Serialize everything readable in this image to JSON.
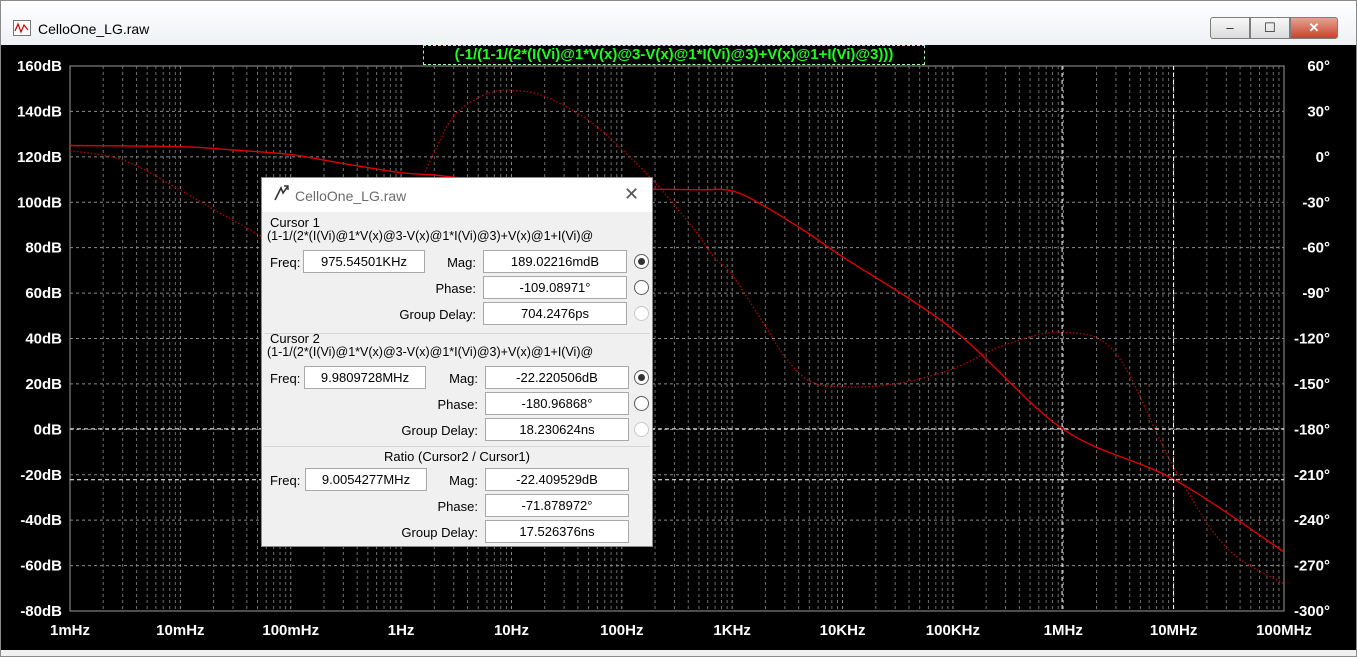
{
  "window": {
    "title": "CelloOne_LG.raw",
    "min_label": "‒",
    "max_label": "☐",
    "close_label": "✕"
  },
  "trace": {
    "expression": "(-1/(1-1/(2*(I(Vi)@1*V(x)@3-V(x)@1*I(Vi)@3)+V(x)@1+I(Vi)@3)))",
    "color": "#1cff1c"
  },
  "plot": {
    "x_ticks": [
      "1mHz",
      "10mHz",
      "100mHz",
      "1Hz",
      "10Hz",
      "100Hz",
      "1KHz",
      "10KHz",
      "100KHz",
      "1MHz",
      "10MHz",
      "100MHz"
    ],
    "y_left_ticks": [
      "160dB",
      "140dB",
      "120dB",
      "100dB",
      "80dB",
      "60dB",
      "40dB",
      "20dB",
      "0dB",
      "-20dB",
      "-40dB",
      "-60dB",
      "-80dB"
    ],
    "y_right_ticks": [
      "60°",
      "30°",
      "0°",
      "-30°",
      "-60°",
      "-90°",
      "-120°",
      "-150°",
      "-180°",
      "-210°",
      "-240°",
      "-270°",
      "-300°"
    ],
    "magnitude_color": "#e00000",
    "phase_color": "#b80000"
  },
  "chart_data": {
    "type": "line",
    "x_scale": "log",
    "x_unit": "Hz",
    "xlim": [
      0.001,
      100000000
    ],
    "ylim": [
      -80,
      160
    ],
    "y2lim": [
      -300,
      60
    ],
    "grid": true,
    "series": [
      {
        "axis": "left",
        "x": [
          0.001,
          0.01,
          0.03,
          0.1,
          0.3,
          1,
          2,
          3,
          5,
          10,
          20,
          50,
          100,
          200,
          500,
          1000,
          2000,
          5000,
          10000,
          100000,
          1000000,
          10000000,
          100000000
        ],
        "y": [
          125,
          124.5,
          123,
          121,
          117,
          113,
          112,
          111,
          110,
          108.5,
          107.5,
          106.5,
          106,
          105.7,
          105.5,
          105,
          98,
          86,
          76,
          44,
          0,
          -22,
          -54
        ]
      },
      {
        "axis": "right",
        "x": [
          0.001,
          0.003,
          0.01,
          0.03,
          0.1,
          0.3,
          0.5,
          1,
          2,
          3,
          5,
          7,
          10,
          20,
          50,
          100,
          200,
          300,
          500,
          700,
          1000,
          2000,
          3000,
          5000,
          10000,
          30000,
          100000,
          300000,
          1000000,
          3000000,
          10000000,
          30000000,
          100000000
        ],
        "y": [
          4,
          -2,
          -22,
          -42,
          -62,
          -72,
          -66,
          -42,
          3,
          27,
          39,
          43,
          44,
          40,
          24,
          5,
          -17,
          -32,
          -52,
          -67,
          -78,
          -112,
          -132,
          -148,
          -152,
          -150,
          -140,
          -124,
          -116,
          -130,
          -205,
          -258,
          -282
        ]
      }
    ]
  },
  "dialog": {
    "title": "CelloOne_LG.raw",
    "close_label": "✕",
    "icon": "probe-icon",
    "cursor1": {
      "heading": "Cursor 1",
      "expression": "(1-1/(2*(I(Vi)@1*V(x)@3-V(x)@1*I(Vi)@3)+V(x)@1+I(Vi)@",
      "freq_label": "Freq:",
      "freq": "975.54501KHz",
      "mag_label": "Mag:",
      "mag": "189.02216mdB",
      "phase_label": "Phase:",
      "phase": "-109.08971°",
      "gd_label": "Group Delay:",
      "gd": "704.2476ps"
    },
    "cursor2": {
      "heading": "Cursor 2",
      "expression": "(1-1/(2*(I(Vi)@1*V(x)@3-V(x)@1*I(Vi)@3)+V(x)@1+I(Vi)@",
      "freq_label": "Freq:",
      "freq": "9.9809728MHz",
      "mag_label": "Mag:",
      "mag": "-22.220506dB",
      "phase_label": "Phase:",
      "phase": "-180.96868°",
      "gd_label": "Group Delay:",
      "gd": "18.230624ns"
    },
    "ratio": {
      "heading": "Ratio (Cursor2 / Cursor1)",
      "freq_label": "Freq:",
      "freq": "9.0054277MHz",
      "mag_label": "Mag:",
      "mag": "-22.409529dB",
      "phase_label": "Phase:",
      "phase": "-71.878972°",
      "gd_label": "Group Delay:",
      "gd": "17.526376ns"
    }
  }
}
